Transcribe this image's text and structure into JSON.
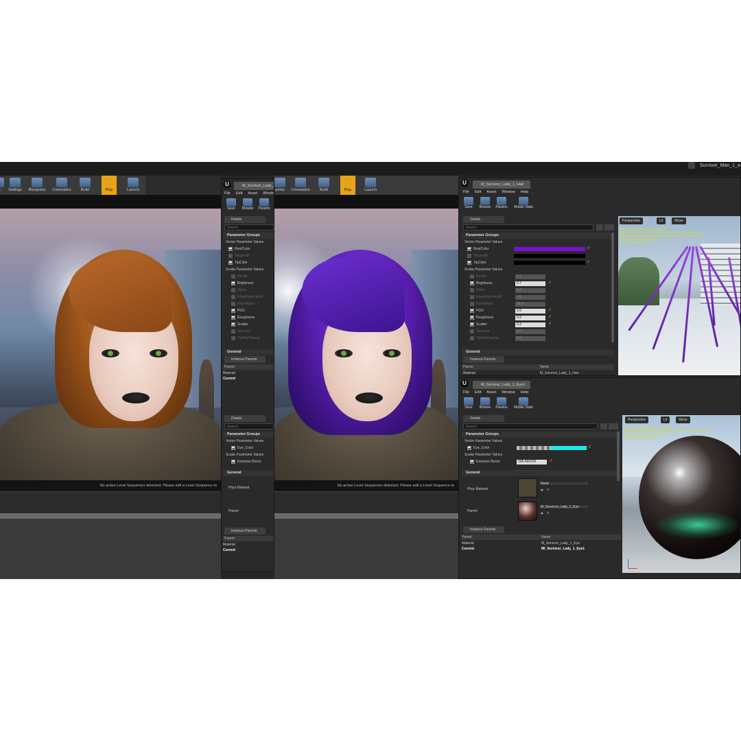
{
  "window": {
    "title": "Survivor_Man_1_a"
  },
  "main_toolbar_left": [
    {
      "label": "ce"
    },
    {
      "label": "Settings"
    },
    {
      "label": "Blueprints"
    },
    {
      "label": "Cinematics"
    },
    {
      "label": "Build"
    },
    {
      "label": "Play"
    },
    {
      "label": "Launch"
    }
  ],
  "main_toolbar_mid": [
    {
      "label": "prints"
    },
    {
      "label": "Cinematics"
    },
    {
      "label": "Build"
    },
    {
      "label": "Play"
    },
    {
      "label": "Launch"
    }
  ],
  "viewport_message": "No active Level Sequencer detected. Please edit a Level Sequence to",
  "colors": {
    "hair_left": "#a0581c",
    "hair_purple": "#5a1fb0",
    "accent": "#e0a516",
    "eye_swatch": "#22e8e8"
  },
  "left_editor": {
    "doc_tab": "M_Survivor_Lady_",
    "menu": [
      "File",
      "Edit",
      "Asset",
      "Window"
    ],
    "tools": [
      {
        "label": "Save"
      },
      {
        "label": "Browse"
      },
      {
        "label": "Params"
      }
    ],
    "details_tab": "Details",
    "search_placeholder": "Search",
    "param_groups": "Parameter Groups",
    "vector_header": "Vector Parameter Values",
    "vector_params": [
      {
        "name": "RootColor",
        "on": true
      },
      {
        "name": "TangentB",
        "on": false
      },
      {
        "name": "TipColor",
        "on": true
      }
    ],
    "scalar_header": "Scalar Parameter Values",
    "scalar_params": [
      {
        "name": "Backlit",
        "on": false
      },
      {
        "name": "Brightness",
        "on": true
      },
      {
        "name": "Dither",
        "on": false
      },
      {
        "name": "EdgeMaskFalloff",
        "on": false
      },
      {
        "name": "MaskAlpha",
        "on": false
      },
      {
        "name": "PDO",
        "on": true
      },
      {
        "name": "Roughness",
        "on": true
      },
      {
        "name": "Scatter",
        "on": true
      },
      {
        "name": "Specular",
        "on": false
      },
      {
        "name": "TipHairOpacity",
        "on": false
      }
    ],
    "general": "General",
    "instance_parents_tab": "Instance Parents",
    "ip_rows": [
      "Parent",
      "Material",
      "Current"
    ],
    "details2_tab": "Details",
    "search2_placeholder": "Search",
    "param_groups2": "Parameter Groups",
    "vector_header2": "Vector Parameter Values",
    "eye_color": "Eye_Color",
    "scalar_header2": "Scalar Parameter Values",
    "emissive": "Emissive Boost",
    "general2": "General",
    "phys_material": "Phys Material",
    "parent_label": "Parent",
    "instance_parents_tab2": "Instance Parents",
    "ip_rows2": [
      "Parent",
      "Material",
      "Current"
    ]
  },
  "hair_editor": {
    "doc_tab": "M_Survivor_Lady_1_Hair",
    "menu": [
      "File",
      "Edit",
      "Asset",
      "Window",
      "Help"
    ],
    "tools": [
      {
        "label": "Save"
      },
      {
        "label": "Browse"
      },
      {
        "label": "Params"
      },
      {
        "label": "Mobile Stats"
      }
    ],
    "details_tab": "Details",
    "search_placeholder": "Search",
    "param_groups": "Parameter Groups",
    "vector_header": "Vector Parameter Values",
    "vector_params": [
      {
        "name": "RootColor",
        "on": true,
        "color": "#7a10d0"
      },
      {
        "name": "TangentB",
        "on": false,
        "color": "#000000"
      },
      {
        "name": "TipColor",
        "on": true,
        "color": "#000000"
      }
    ],
    "scalar_header": "Scalar Parameter Values",
    "scalar_params": [
      {
        "name": "Backlit",
        "on": false,
        "value": "0.1"
      },
      {
        "name": "Brightness",
        "on": true,
        "value": "0.7"
      },
      {
        "name": "Dither",
        "on": false,
        "value": "1.0"
      },
      {
        "name": "EdgeMaskFalloff",
        "on": false,
        "value": "1.0"
      },
      {
        "name": "MaskAlpha",
        "on": false,
        "value": "24.0"
      },
      {
        "name": "PDO",
        "on": true,
        "value": "0.0"
      },
      {
        "name": "Roughness",
        "on": true,
        "value": "0.9"
      },
      {
        "name": "Scatter",
        "on": true,
        "value": "0.3"
      },
      {
        "name": "Specular",
        "on": false,
        "value": "0.0"
      },
      {
        "name": "TipHairOpacity",
        "on": false,
        "value": "0.0"
      }
    ],
    "general": "General",
    "instance_parents_tab": "Instance Parents",
    "ip_header": [
      "Parent",
      "Name"
    ],
    "ip_rows": [
      {
        "parent": "Material",
        "name": "M_Survivor_Lady_1_Hair"
      }
    ],
    "viewport_buttons": [
      "Perspective",
      "Lit",
      "Show"
    ],
    "stats": [
      "Base pass shader: 150 instructions",
      "Base pass shader with Surface Lightmap: 177 instructions",
      "Base pass shader with Volumetric Lightmap: 172 instructions",
      "Vertex shader: 20 instructions",
      "Texture samplers: 8/16"
    ]
  },
  "eye_editor": {
    "doc_tab": "M_Survivor_Lady_1_Eye1",
    "menu": [
      "File",
      "Edit",
      "Asset",
      "Window",
      "Help"
    ],
    "tools": [
      {
        "label": "Save"
      },
      {
        "label": "Browse"
      },
      {
        "label": "Params"
      },
      {
        "label": "Mobile Stats"
      }
    ],
    "details_tab": "Details",
    "search_placeholder": "Search",
    "param_groups": "Parameter Groups",
    "vector_header": "Vector Parameter Values",
    "eye_color": "Eye_Color",
    "scalar_header": "Scalar Parameter Values",
    "emissive": "Emissive Boost",
    "emissive_value": "168.466293",
    "general": "General",
    "phys_material": "Phys Material",
    "phys_value": "None",
    "parent_label": "Parent",
    "parent_value": "M_Survivor_Lady_1_Eye",
    "instance_parents_tab": "Instance Parents",
    "ip_header": [
      "Parent",
      "Name"
    ],
    "ip_rows": [
      {
        "parent": "Material",
        "name": "M_Survivor_Lady_1_Eye",
        "bold": false
      },
      {
        "parent": "Current",
        "name": "MI_Survivor_Lady_1_Eye1",
        "bold": true
      }
    ],
    "viewport_buttons": [
      "Perspective",
      "Lit",
      "Show"
    ],
    "stats": [
      "Base pass shader: 116 instructions",
      "Base pass shader with Volumetric Lightmap: 139 instructions",
      "Vertex shader: 29 instructions",
      "Texture samplers: 5/16"
    ]
  }
}
